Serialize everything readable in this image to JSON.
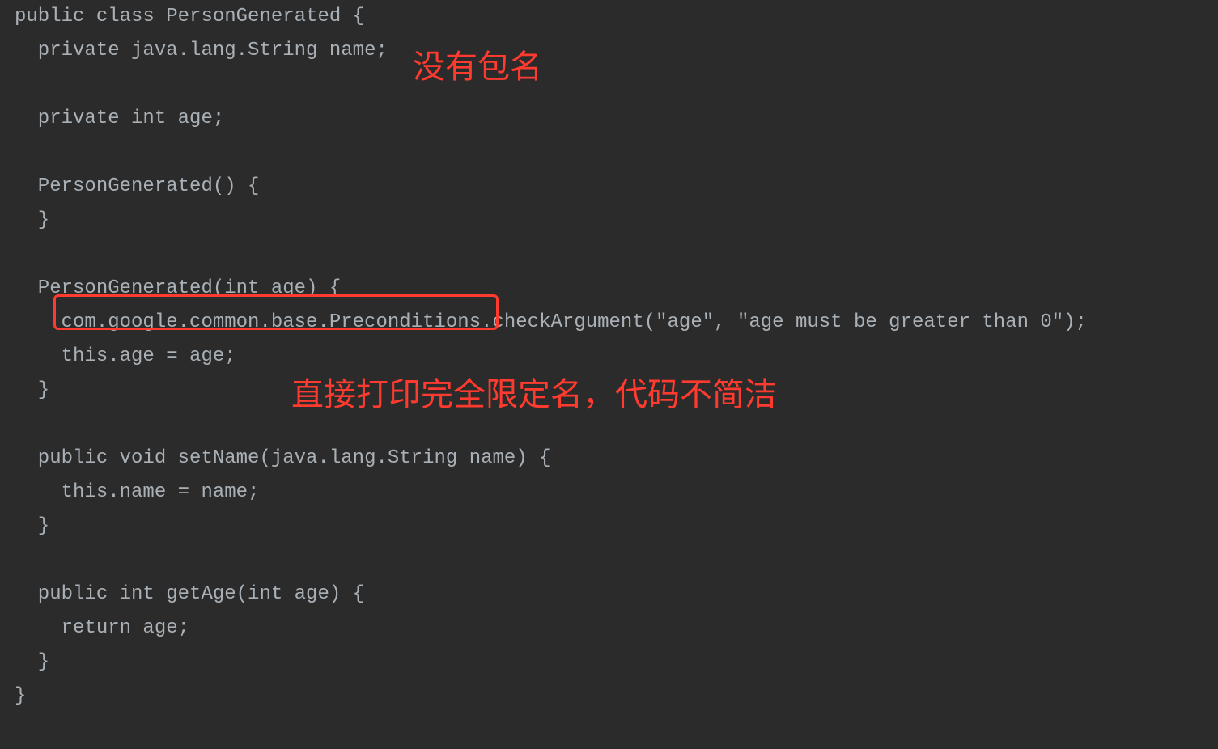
{
  "code": {
    "line1": "public class PersonGenerated {",
    "line2": "  private java.lang.String name;",
    "line3": "",
    "line4": "  private int age;",
    "line5": "",
    "line6": "  PersonGenerated() {",
    "line7": "  }",
    "line8": "",
    "line9": "  PersonGenerated(int age) {",
    "line10": "    com.google.common.base.Preconditions.checkArgument(\"age\", \"age must be greater than 0\");",
    "line11": "    this.age = age;",
    "line12": "  }",
    "line13": "",
    "line14": "  public void setName(java.lang.String name) {",
    "line15": "    this.name = name;",
    "line16": "  }",
    "line17": "",
    "line18": "  public int getAge(int age) {",
    "line19": "    return age;",
    "line20": "  }",
    "line21": "}"
  },
  "annotations": {
    "top": "没有包名",
    "middle": "直接打印完全限定名，代码不简洁"
  },
  "highlight": {
    "description": "com.google.common.base.Preconditions"
  },
  "colors": {
    "background": "#2b2b2b",
    "codeText": "#a9b0b6",
    "annotation": "#ff3b30"
  }
}
